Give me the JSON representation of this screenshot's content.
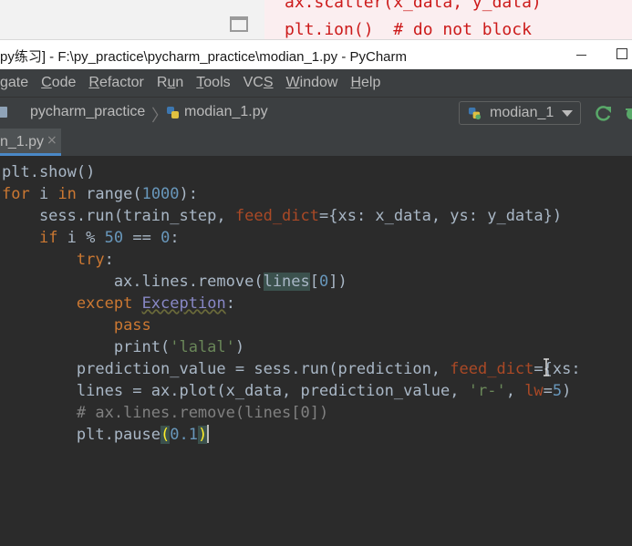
{
  "background_window": {
    "code_line_1": "ax.scatter(x_data, y_data)",
    "code_line_2": "plt.ion()  # do not block"
  },
  "window": {
    "title": "py练习] - F:\\py_practice\\pycharm_practice\\modian_1.py - PyCharm"
  },
  "menu": {
    "items": [
      {
        "pre": "",
        "ul": "",
        "post": "gate"
      },
      {
        "pre": "",
        "ul": "C",
        "post": "ode"
      },
      {
        "pre": "",
        "ul": "R",
        "post": "efactor"
      },
      {
        "pre": "R",
        "ul": "u",
        "post": "n"
      },
      {
        "pre": "",
        "ul": "T",
        "post": "ools"
      },
      {
        "pre": "VC",
        "ul": "S",
        "post": ""
      },
      {
        "pre": "",
        "ul": "W",
        "post": "indow"
      },
      {
        "pre": "",
        "ul": "H",
        "post": "elp"
      }
    ]
  },
  "nav": {
    "project": "pycharm_practice",
    "file": "modian_1.py",
    "run_config": "modian_1"
  },
  "tab": {
    "label": "n_1.py",
    "close": "×"
  },
  "editor": {
    "lines": [
      "plt.show()",
      "for i in range(1000):",
      "    sess.run(train_step, feed_dict={xs: x_data, ys: y_data})",
      "    if i % 50 == 0:",
      "        try:",
      "            ax.lines.remove(lines[0])",
      "        except Exception:",
      "            pass",
      "            print('lalal')",
      "        prediction_value = sess.run(prediction, feed_dict={xs:",
      "        lines = ax.plot(x_data, prediction_value, 'r-', lw=5)",
      "        # ax.lines.remove(lines[0])",
      "        plt.pause(0.1)"
    ]
  },
  "colors": {
    "editor_bg": "#2b2b2b",
    "keyword": "#cc7832",
    "number": "#6897bb",
    "string": "#6a8759",
    "param": "#aa4926",
    "comment": "#808080",
    "accent": "#4a88c7"
  }
}
